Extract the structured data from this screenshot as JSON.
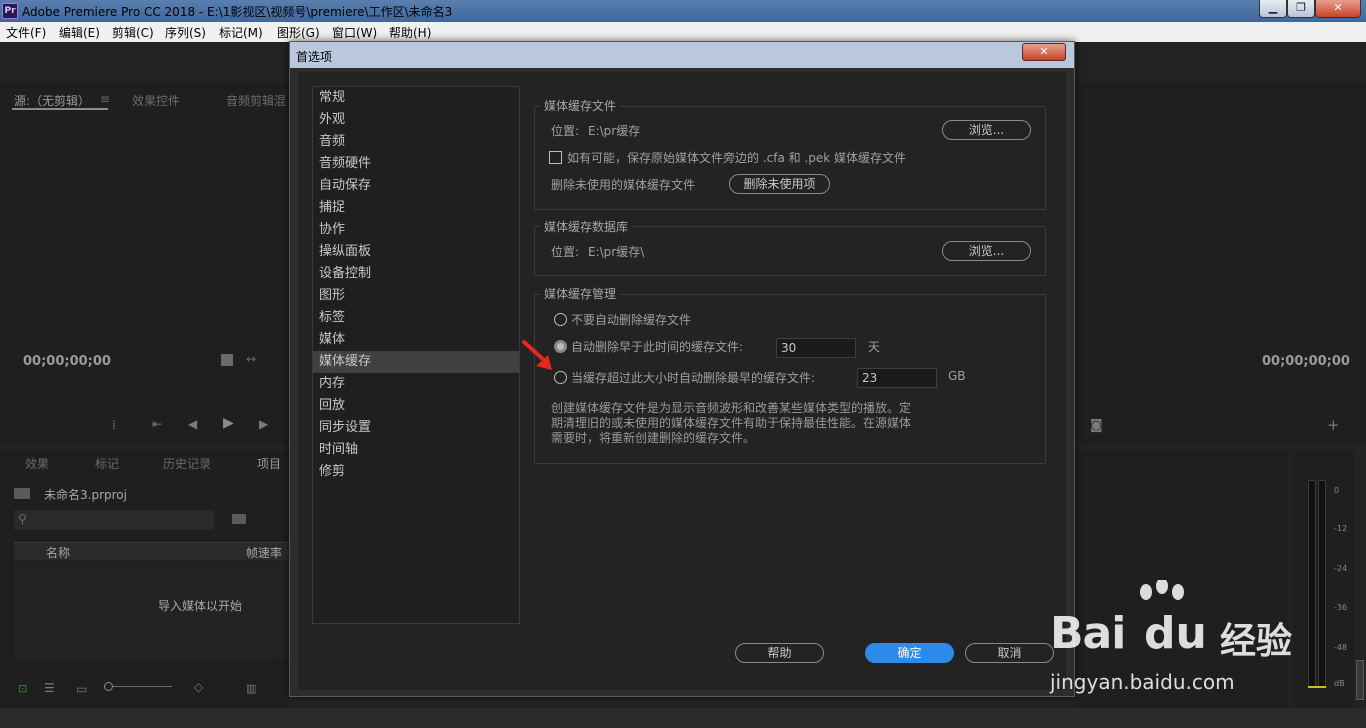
{
  "window": {
    "title": "Adobe Premiere Pro CC 2018 - E:\\1影视区\\视频号\\premiere\\工作区\\未命名3",
    "app_icon": "Pr"
  },
  "menu": [
    "文件(F)",
    "编辑(E)",
    "剪辑(C)",
    "序列(S)",
    "标记(M)",
    "图形(G)",
    "窗口(W)",
    "帮助(H)"
  ],
  "source_panel": {
    "tabs": [
      "源:（无剪辑）",
      "效果控件",
      "音频剪辑混"
    ],
    "timecode": "00;00;00;00"
  },
  "program_panel": {
    "timecode": "00;00;00;00"
  },
  "project_panel": {
    "tabs": [
      "效果",
      "标记",
      "历史记录",
      "项目"
    ],
    "project_name": "未命名3.prproj",
    "columns": [
      "名称",
      "帧速率"
    ],
    "empty_text": "导入媒体以开始"
  },
  "meter": {
    "labels": [
      "0",
      "-12",
      "-24",
      "-36",
      "-48",
      "dB"
    ]
  },
  "dialog": {
    "title": "首选项",
    "categories": [
      "常规",
      "外观",
      "音频",
      "音频硬件",
      "自动保存",
      "捕捉",
      "协作",
      "操纵面板",
      "设备控制",
      "图形",
      "标签",
      "媒体",
      "媒体缓存",
      "内存",
      "回放",
      "同步设置",
      "时间轴",
      "修剪"
    ],
    "selected_category": "媒体缓存",
    "cache_files": {
      "title": "媒体缓存文件",
      "location_label": "位置:",
      "location_value": "E:\\pr缓存",
      "browse": "浏览...",
      "checkbox_label": "如有可能，保存原始媒体文件旁边的 .cfa 和 .pek 媒体缓存文件",
      "delete_label": "删除未使用的媒体缓存文件",
      "delete_button": "删除未使用项"
    },
    "cache_db": {
      "title": "媒体缓存数据库",
      "location_label": "位置:",
      "location_value": "E:\\pr缓存\\",
      "browse": "浏览..."
    },
    "cache_mgmt": {
      "title": "媒体缓存管理",
      "opt1": "不要自动删除缓存文件",
      "opt2": "自动删除早于此时间的缓存文件:",
      "opt2_value": "30",
      "opt2_unit": "天",
      "opt3": "当缓存超过此大小时自动删除最早的缓存文件:",
      "opt3_value": "23",
      "opt3_unit": "GB",
      "description": [
        "创建媒体缓存文件是为显示音频波形和改善某些媒体类型的播放。定",
        "期清理旧的或未使用的媒体缓存文件有助于保持最佳性能。在源媒体",
        "需要时，将重新创建删除的缓存文件。"
      ]
    },
    "buttons": {
      "help": "帮助",
      "ok": "确定",
      "cancel": "取消"
    }
  },
  "watermark": {
    "brand": "Bai",
    "brand2": "du",
    "cn": "经验",
    "url": "jingyan.baidu.com"
  }
}
